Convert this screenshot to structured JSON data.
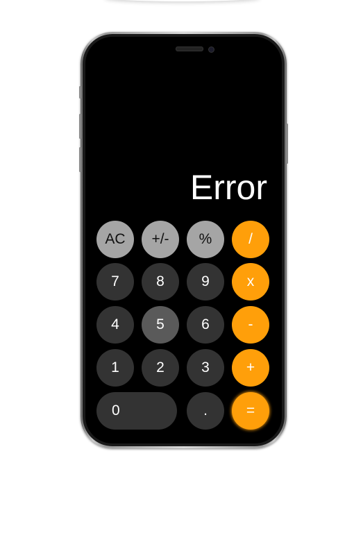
{
  "display": {
    "value": "Error"
  },
  "keys": {
    "ac": "AC",
    "sign": "+/-",
    "percent": "%",
    "divide": "/",
    "seven": "7",
    "eight": "8",
    "nine": "9",
    "multiply": "x",
    "four": "4",
    "five": "5",
    "six": "6",
    "subtract": "-",
    "one": "1",
    "two": "2",
    "three": "3",
    "add": "+",
    "zero": "0",
    "decimal": ".",
    "equals": "="
  },
  "colors": {
    "operator": "#ff9f0a",
    "function": "#a5a5a5",
    "digit": "#333333",
    "digit_pressed": "#5a5a5a",
    "screen": "#000000"
  }
}
